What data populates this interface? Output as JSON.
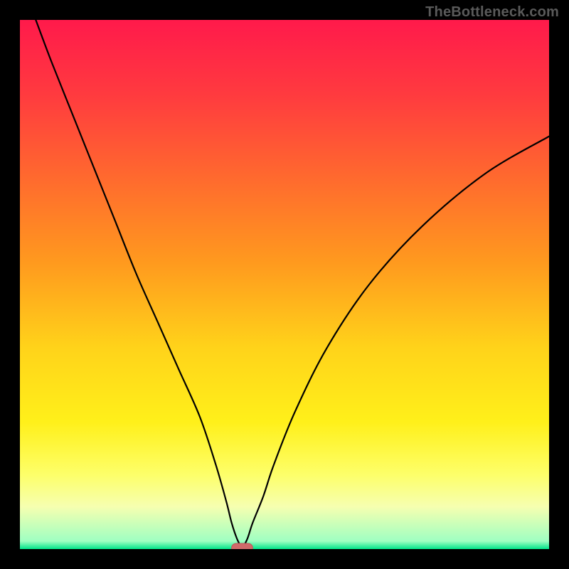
{
  "watermark": "TheBottleneck.com",
  "colors": {
    "frame": "#000000",
    "gradient_stops": [
      {
        "offset": 0.0,
        "color": "#ff1a4b"
      },
      {
        "offset": 0.14,
        "color": "#ff3a3f"
      },
      {
        "offset": 0.3,
        "color": "#ff6a2e"
      },
      {
        "offset": 0.46,
        "color": "#ff9a1e"
      },
      {
        "offset": 0.62,
        "color": "#ffd31a"
      },
      {
        "offset": 0.76,
        "color": "#fff01a"
      },
      {
        "offset": 0.86,
        "color": "#fdff6a"
      },
      {
        "offset": 0.92,
        "color": "#f6ffb0"
      },
      {
        "offset": 0.985,
        "color": "#9fffc2"
      },
      {
        "offset": 1.0,
        "color": "#00e38a"
      }
    ],
    "curve": "#000000",
    "marker_fill": "#d06a6a",
    "marker_edge": "#c05858"
  },
  "chart_data": {
    "type": "line",
    "title": "",
    "xlabel": "",
    "ylabel": "",
    "xlim": [
      0,
      100
    ],
    "ylim": [
      0,
      100
    ],
    "note": "Bottleneck-style curve: |value - optimum| mapped through a saturating function. Color gradient encodes bottleneck severity from red (high) to green (none).",
    "optimum_x": 42,
    "marker": {
      "x_range": [
        40,
        44
      ],
      "y": 0
    },
    "series": [
      {
        "name": "left-branch",
        "x": [
          3,
          6,
          10,
          14,
          18,
          22,
          26,
          30,
          34,
          37,
          39,
          40,
          41,
          42
        ],
        "y": [
          100,
          92,
          82,
          72,
          62,
          52,
          43,
          34,
          25,
          16,
          9,
          5,
          2,
          0
        ]
      },
      {
        "name": "right-branch",
        "x": [
          42,
          43,
          44,
          46,
          48,
          52,
          58,
          66,
          76,
          88,
          100
        ],
        "y": [
          0,
          2,
          5,
          10,
          16,
          26,
          38,
          50,
          61,
          71,
          78
        ]
      }
    ]
  }
}
